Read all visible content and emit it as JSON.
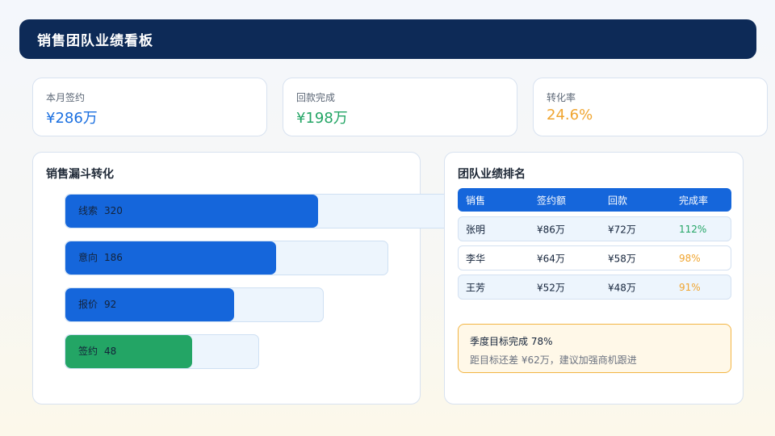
{
  "header": {
    "title": "销售团队业绩看板"
  },
  "kpis": [
    {
      "label": "本月签约",
      "value": "¥286万",
      "color": "#1a6fe0"
    },
    {
      "label": "回款完成",
      "value": "¥198万",
      "color": "#23a565"
    },
    {
      "label": "转化率",
      "value": "24.6%",
      "color": "#f0a530"
    }
  ],
  "funnel": {
    "title": "销售漏斗转化",
    "stages": [
      {
        "label": "线索",
        "value": "320",
        "color": "#1566db"
      },
      {
        "label": "意向",
        "value": "186",
        "color": "#1566db"
      },
      {
        "label": "报价",
        "value": "92",
        "color": "#1566db"
      },
      {
        "label": "签约",
        "value": "48",
        "color": "#23a565"
      }
    ]
  },
  "ranking": {
    "title": "团队业绩排名",
    "columns": [
      "销售",
      "签约额",
      "回款",
      "完成率"
    ],
    "rows": [
      {
        "name": "张明",
        "signed": "¥86万",
        "collected": "¥72万",
        "rate": "112%",
        "rate_color": "#23a565",
        "bg": "#edf5fd"
      },
      {
        "name": "李华",
        "signed": "¥64万",
        "collected": "¥58万",
        "rate": "98%",
        "rate_color": "#f0a530",
        "bg": "#ffffff"
      },
      {
        "name": "王芳",
        "signed": "¥52万",
        "collected": "¥48万",
        "rate": "91%",
        "rate_color": "#f0a530",
        "bg": "#edf5fd"
      }
    ]
  },
  "note": {
    "title": "季度目标完成 78%",
    "detail": "距目标还差 ¥62万，建议加强商机跟进"
  }
}
